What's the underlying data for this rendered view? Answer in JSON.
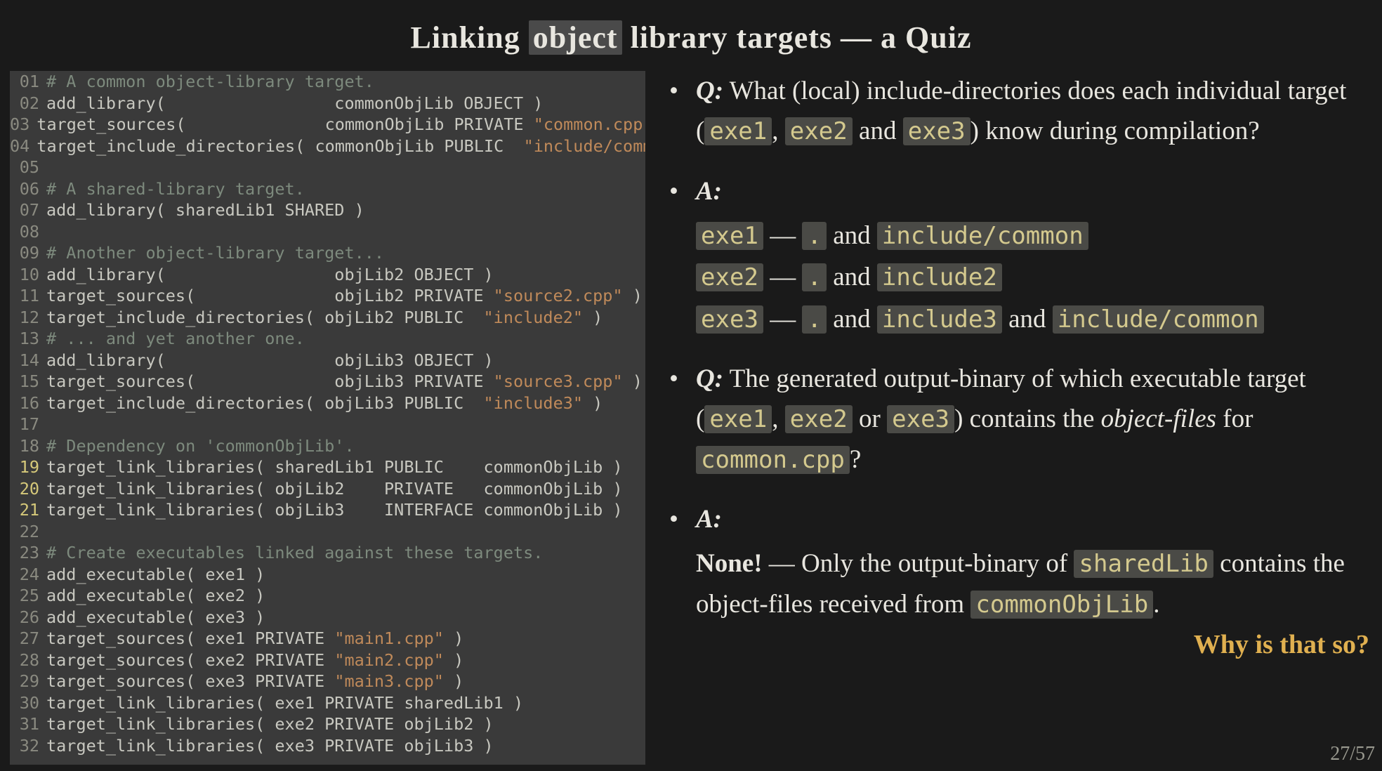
{
  "title_parts": [
    "Linking ",
    "object",
    " library targets — a Quiz"
  ],
  "code": {
    "highlight_lines": [
      19,
      20,
      21
    ],
    "lines": [
      [
        {
          "t": "# A common object-library target.",
          "c": "cmt"
        }
      ],
      [
        {
          "t": "add_library(                 commonObjLib OBJECT )",
          "c": "fn"
        }
      ],
      [
        {
          "t": "target_sources(              commonObjLib PRIVATE ",
          "c": "fn"
        },
        {
          "t": "\"common.cpp\"",
          "c": "str"
        },
        {
          "t": " )",
          "c": "fn"
        }
      ],
      [
        {
          "t": "target_include_directories( commonObjLib PUBLIC  ",
          "c": "fn"
        },
        {
          "t": "\"include/common\"",
          "c": "str"
        },
        {
          "t": " )",
          "c": "fn"
        }
      ],
      [
        {
          "t": "",
          "c": "txt"
        }
      ],
      [
        {
          "t": "# A shared-library target.",
          "c": "cmt"
        }
      ],
      [
        {
          "t": "add_library( sharedLib1 SHARED )",
          "c": "fn"
        }
      ],
      [
        {
          "t": "",
          "c": "txt"
        }
      ],
      [
        {
          "t": "# Another object-library target...",
          "c": "cmt"
        }
      ],
      [
        {
          "t": "add_library(                 objLib2 OBJECT )",
          "c": "fn"
        }
      ],
      [
        {
          "t": "target_sources(              objLib2 PRIVATE ",
          "c": "fn"
        },
        {
          "t": "\"source2.cpp\"",
          "c": "str"
        },
        {
          "t": " )",
          "c": "fn"
        }
      ],
      [
        {
          "t": "target_include_directories( objLib2 PUBLIC  ",
          "c": "fn"
        },
        {
          "t": "\"include2\"",
          "c": "str"
        },
        {
          "t": " )",
          "c": "fn"
        }
      ],
      [
        {
          "t": "# ... and yet another one.",
          "c": "cmt"
        }
      ],
      [
        {
          "t": "add_library(                 objLib3 OBJECT )",
          "c": "fn"
        }
      ],
      [
        {
          "t": "target_sources(              objLib3 PRIVATE ",
          "c": "fn"
        },
        {
          "t": "\"source3.cpp\"",
          "c": "str"
        },
        {
          "t": " )",
          "c": "fn"
        }
      ],
      [
        {
          "t": "target_include_directories( objLib3 PUBLIC  ",
          "c": "fn"
        },
        {
          "t": "\"include3\"",
          "c": "str"
        },
        {
          "t": " )",
          "c": "fn"
        }
      ],
      [
        {
          "t": "",
          "c": "txt"
        }
      ],
      [
        {
          "t": "# Dependency on 'commonObjLib'.",
          "c": "cmt"
        }
      ],
      [
        {
          "t": "target_link_libraries( sharedLib1 PUBLIC    commonObjLib )",
          "c": "fn"
        }
      ],
      [
        {
          "t": "target_link_libraries( objLib2    PRIVATE   commonObjLib )",
          "c": "fn"
        }
      ],
      [
        {
          "t": "target_link_libraries( objLib3    INTERFACE commonObjLib )",
          "c": "fn"
        }
      ],
      [
        {
          "t": "",
          "c": "txt"
        }
      ],
      [
        {
          "t": "# Create executables linked against these targets.",
          "c": "cmt"
        }
      ],
      [
        {
          "t": "add_executable( exe1 )",
          "c": "fn"
        }
      ],
      [
        {
          "t": "add_executable( exe2 )",
          "c": "fn"
        }
      ],
      [
        {
          "t": "add_executable( exe3 )",
          "c": "fn"
        }
      ],
      [
        {
          "t": "target_sources( exe1 PRIVATE ",
          "c": "fn"
        },
        {
          "t": "\"main1.cpp\"",
          "c": "str"
        },
        {
          "t": " )",
          "c": "fn"
        }
      ],
      [
        {
          "t": "target_sources( exe2 PRIVATE ",
          "c": "fn"
        },
        {
          "t": "\"main2.cpp\"",
          "c": "str"
        },
        {
          "t": " )",
          "c": "fn"
        }
      ],
      [
        {
          "t": "target_sources( exe3 PRIVATE ",
          "c": "fn"
        },
        {
          "t": "\"main3.cpp\"",
          "c": "str"
        },
        {
          "t": " )",
          "c": "fn"
        }
      ],
      [
        {
          "t": "target_link_libraries( exe1 PRIVATE sharedLib1 )",
          "c": "fn"
        }
      ],
      [
        {
          "t": "target_link_libraries( exe2 PRIVATE objLib2 )",
          "c": "fn"
        }
      ],
      [
        {
          "t": "target_link_libraries( exe3 PRIVATE objLib3 )",
          "c": "fn"
        }
      ]
    ]
  },
  "q1": {
    "label": "Q:",
    "pre": " What (local) include-directories does each individual target (",
    "t1": "exe1",
    "sep1": ", ",
    "t2": "exe2",
    "sep2": " and ",
    "t3": "exe3",
    "post": ") know during compilation?"
  },
  "a1": {
    "label": "A:",
    "lines": [
      {
        "target": "exe1",
        "dash": " — ",
        "d0": ".",
        "and1": " and ",
        "d1": "include/common"
      },
      {
        "target": "exe2",
        "dash": " — ",
        "d0": ".",
        "and1": " and ",
        "d1": "include2"
      },
      {
        "target": "exe3",
        "dash": " — ",
        "d0": ".",
        "and1": " and ",
        "d1": "include3",
        "and2": " and ",
        "d2": "include/common"
      }
    ]
  },
  "q2": {
    "label": "Q:",
    "pre": " The generated output-binary of which executable target (",
    "t1": "exe1",
    "sep1": ", ",
    "t2": "exe2",
    "sep2": " or ",
    "t3": "exe3",
    "mid": ") contains the ",
    "ital": "object-files",
    "for": " for ",
    "file": "common.cpp",
    "qmark": "?"
  },
  "a2": {
    "label": "A:",
    "none": "None!",
    "dash": " — Only the output-binary of ",
    "sharedlib": "sharedLib",
    "mid": " contains the object-files received from ",
    "common": "commonObjLib",
    "dot": "."
  },
  "why": "Why is that so?",
  "pagenum": "27/57"
}
